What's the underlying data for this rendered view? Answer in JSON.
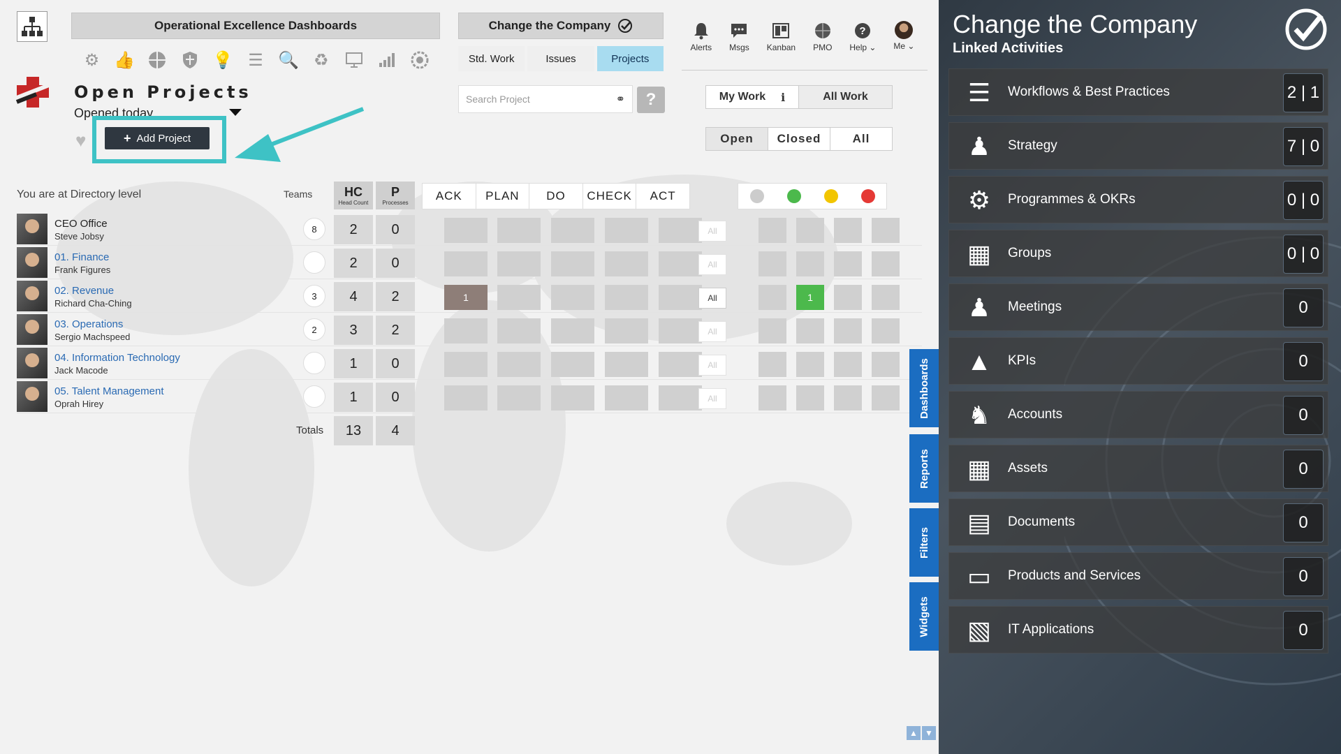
{
  "header": {
    "dashboard_title": "Operational Excellence Dashboards",
    "dashboard_icons": [
      "brain-icon",
      "thumbs-up-icon",
      "globe-icon",
      "shield-icon",
      "lightbulb-icon",
      "list-icon",
      "search-icon",
      "recycle-icon",
      "presentation-icon",
      "bar-chart-icon",
      "gear-icon"
    ],
    "context_title": "Change the Company",
    "tabs": [
      {
        "label": "Std. Work",
        "active": false
      },
      {
        "label": "Issues",
        "active": false
      },
      {
        "label": "Projects",
        "active": true
      }
    ],
    "nav": [
      {
        "label": "Alerts",
        "icon": "bell-icon"
      },
      {
        "label": "Msgs",
        "icon": "chat-icon"
      },
      {
        "label": "Kanban",
        "icon": "kanban-icon"
      },
      {
        "label": "PMO",
        "icon": "pmo-icon"
      },
      {
        "label": "Help",
        "icon": "help-icon"
      },
      {
        "label": "Me",
        "icon": "avatar"
      }
    ]
  },
  "page": {
    "title": "Open Projects",
    "filter": "Opened today",
    "add_button": "Add Project",
    "search_placeholder": "Search Project",
    "help_label": "?",
    "work_toggle": [
      "My Work",
      "All Work"
    ],
    "work_info": "i",
    "status_filters": [
      "Open",
      "Closed",
      "All"
    ],
    "level_text": "You are at Directory level",
    "teams_label": "Teams"
  },
  "table": {
    "hc_header": "HC",
    "hc_sub": "Head Count",
    "p_header": "P",
    "p_sub": "Processes",
    "phases": [
      "ACK",
      "PLAN",
      "DO",
      "CHECK",
      "ACT"
    ],
    "status_colors": [
      "#cccccc",
      "#4cb94c",
      "#f2c500",
      "#e53935"
    ],
    "all_label": "All",
    "rows": [
      {
        "name": "CEO Office",
        "owner": "Steve Jobsy",
        "teams": "8",
        "hc": "2",
        "p": "0",
        "ack": "",
        "all_active": false,
        "green": ""
      },
      {
        "name": "01. Finance",
        "owner": "Frank Figures",
        "teams": "",
        "hc": "2",
        "p": "0",
        "ack": "",
        "all_active": false,
        "green": ""
      },
      {
        "name": "02. Revenue",
        "owner": "Richard Cha-Ching",
        "teams": "3",
        "hc": "4",
        "p": "2",
        "ack": "1",
        "all_active": true,
        "green": "1"
      },
      {
        "name": "03. Operations",
        "owner": "Sergio Machspeed",
        "teams": "2",
        "hc": "3",
        "p": "2",
        "ack": "",
        "all_active": false,
        "green": ""
      },
      {
        "name": "04. Information Technology",
        "owner": "Jack Macode",
        "teams": "",
        "hc": "1",
        "p": "0",
        "ack": "",
        "all_active": false,
        "green": ""
      },
      {
        "name": "05. Talent Management",
        "owner": "Oprah Hirey",
        "teams": "",
        "hc": "1",
        "p": "0",
        "ack": "",
        "all_active": false,
        "green": ""
      }
    ],
    "totals_label": "Totals",
    "total_hc": "13",
    "total_p": "4"
  },
  "side_tabs": [
    "Dashboards",
    "Reports",
    "Filters",
    "Widgets"
  ],
  "panel": {
    "title": "Change the Company",
    "subtitle": "Linked Activities",
    "items": [
      {
        "label": "Workflows & Best Practices",
        "count": "2 | 1",
        "icon": "workflow-icon"
      },
      {
        "label": "Strategy",
        "count": "7 | 0",
        "icon": "strategy-icon"
      },
      {
        "label": "Programmes & OKRs",
        "count": "0 | 0",
        "icon": "programmes-icon"
      },
      {
        "label": "Groups",
        "count": "0 | 0",
        "icon": "groups-icon"
      },
      {
        "label": "Meetings",
        "count": "0",
        "icon": "meetings-icon"
      },
      {
        "label": "KPIs",
        "count": "0",
        "icon": "kpi-icon"
      },
      {
        "label": "Accounts",
        "count": "0",
        "icon": "accounts-icon"
      },
      {
        "label": "Assets",
        "count": "0",
        "icon": "assets-icon"
      },
      {
        "label": "Documents",
        "count": "0",
        "icon": "documents-icon"
      },
      {
        "label": "Products and Services",
        "count": "0",
        "icon": "products-icon"
      },
      {
        "label": "IT Applications",
        "count": "0",
        "icon": "it-applications-icon"
      }
    ]
  }
}
